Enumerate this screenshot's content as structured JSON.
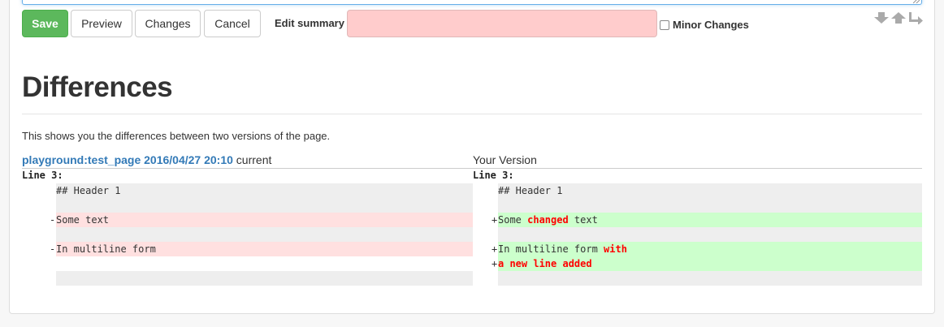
{
  "toolbar": {
    "save_label": "Save",
    "preview_label": "Preview",
    "changes_label": "Changes",
    "cancel_label": "Cancel",
    "summary_label": "Edit summary",
    "summary_value": "",
    "minor_label": "Minor Changes",
    "minor_checked": false
  },
  "nav_icons": [
    "arrow-down-icon",
    "arrow-up-icon",
    "return-icon"
  ],
  "colors": {
    "save": "#5cb85c",
    "summary_bg": "#ffcccc",
    "link": "#337ab7",
    "deleted_bg": "#ffe0e0",
    "added_bg": "#ccffcc",
    "context_bg": "#eeeeee",
    "highlight": "#ff0000"
  },
  "page": {
    "title": "Differences",
    "description": "This shows you the differences between two versions of the page."
  },
  "diff": {
    "left_header": {
      "link_text": "playground:test_page 2016/04/27 20:10",
      "suffix": " current"
    },
    "right_header": "Your Version",
    "left_line_label": "Line 3:",
    "right_line_label": "Line 3:",
    "left": {
      "header_line": "## Header 1",
      "line1": "Some text",
      "line2": "In multiline form"
    },
    "right": {
      "header_line": "## Header 1",
      "line1_a": "Some ",
      "line1_hl": "changed",
      "line1_b": " text",
      "line2_a": "In multiline form ",
      "line2_hl": "with",
      "line3_hl": "a new line added"
    },
    "del_marker": "-",
    "add_marker": "+"
  }
}
